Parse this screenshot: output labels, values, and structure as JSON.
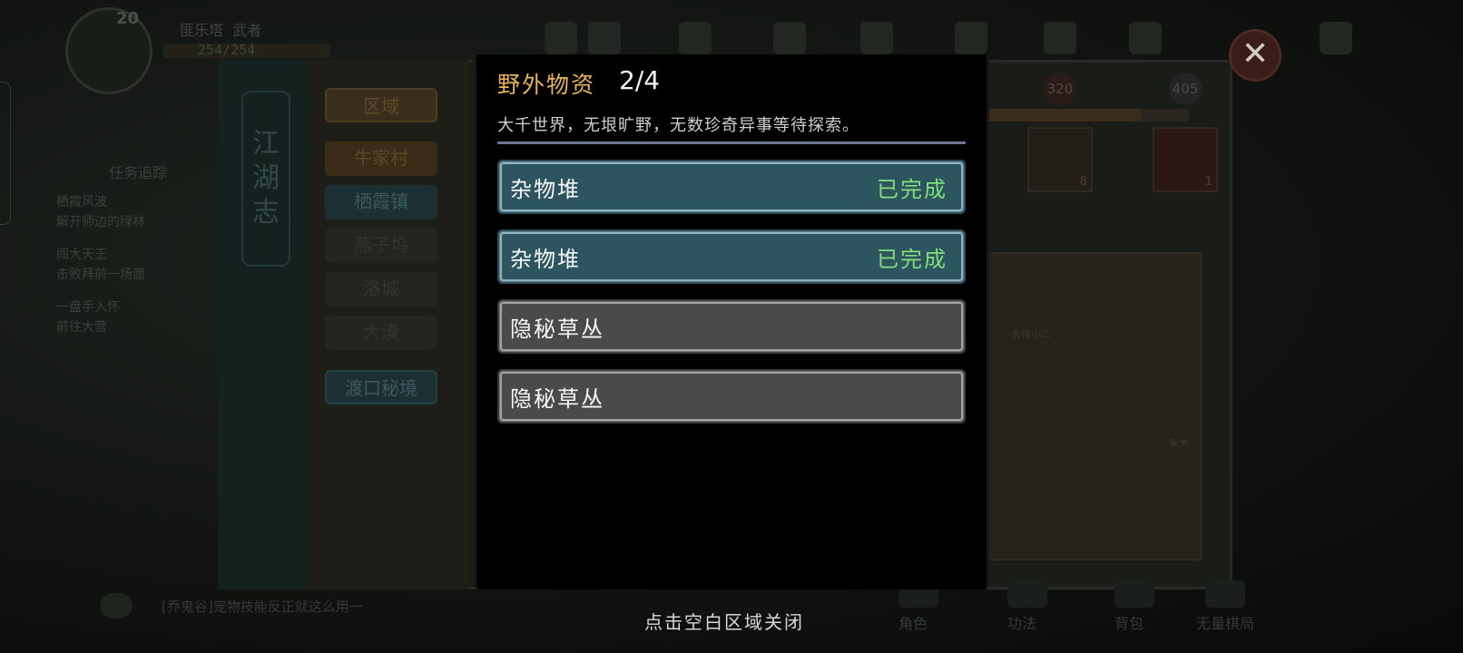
{
  "hud": {
    "level": "20",
    "player_name": "匪乐塔",
    "player_tag": "武者",
    "hp": "254/254"
  },
  "task_tracker": {
    "title": "任务追踪",
    "lines": [
      "栖霞风波",
      "解开师边的绿林",
      "闯大天王",
      "击败拜前一场面",
      "一盘手入怀",
      "前往大营"
    ]
  },
  "book": {
    "title": "江湖志",
    "regions_header": "区域",
    "regions": [
      {
        "label": "牛家村",
        "state": "normal"
      },
      {
        "label": "栖霞镇",
        "state": "selected"
      },
      {
        "label": "燕子坞",
        "state": "locked"
      },
      {
        "label": "洛城",
        "state": "locked"
      },
      {
        "label": "大漠",
        "state": "locked"
      }
    ],
    "secret_realm": "渡口秘境",
    "stat_a": "320",
    "stat_b": "405",
    "item_count_a": "8",
    "item_count_b": "1",
    "map_npc_a": "舍律小二",
    "map_npc_b": "朱大"
  },
  "modal": {
    "title": "野外物资",
    "count": "2/4",
    "description": "大千世界，无垠旷野，无数珍奇异事等待探索。",
    "entries": [
      {
        "name": "杂物堆",
        "status": "已完成",
        "done": true
      },
      {
        "name": "杂物堆",
        "status": "已完成",
        "done": true
      },
      {
        "name": "隐秘草丛",
        "status": "",
        "done": false
      },
      {
        "name": "隐秘草丛",
        "status": "",
        "done": false
      }
    ],
    "close_hint": "点击空白区域关闭"
  },
  "chat": {
    "text": "[乔鬼谷]宠物技能反正就这么用一"
  },
  "bottom_nav": [
    "角色",
    "功法",
    "背包",
    "无量棋局"
  ],
  "colors": {
    "title_gold": "#e8b45a",
    "done_green": "#7fe07a",
    "done_bg": "#2d5560",
    "todo_bg": "#4a4a4a"
  }
}
